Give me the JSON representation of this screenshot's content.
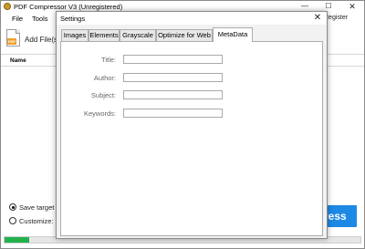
{
  "app": {
    "title": "PDF Compressor V3 (Unregistered)",
    "window_controls": {
      "minimize": "—",
      "maximize": "☐",
      "close": "✕"
    }
  },
  "menu": {
    "file": "File",
    "tools": "Tools",
    "register": "Register"
  },
  "toolbar": {
    "add_files_label": "Add File(s)",
    "pdf_badge": "PDF"
  },
  "file_list": {
    "columns": [
      "Name"
    ]
  },
  "options": {
    "save_target": "Save target fil",
    "customize": "Customize:",
    "selected": "save_target"
  },
  "actions": {
    "compress_label": "ress"
  },
  "progress": {
    "fraction": 0.07,
    "color": "#22b14c"
  },
  "dialog": {
    "title": "Settings",
    "close": "✕",
    "tabs": [
      "Images",
      "Elements",
      "Grayscale",
      "Optimize for Web",
      "MetaData"
    ],
    "active_tab": "MetaData",
    "fields": {
      "title_label": "Title:",
      "title_value": "",
      "author_label": "Author:",
      "author_value": "",
      "subject_label": "Subject:",
      "subject_value": "",
      "keywords_label": "Keywords:",
      "keywords_value": ""
    }
  },
  "colors": {
    "accent": "#1e88e5",
    "progress": "#22b14c"
  }
}
